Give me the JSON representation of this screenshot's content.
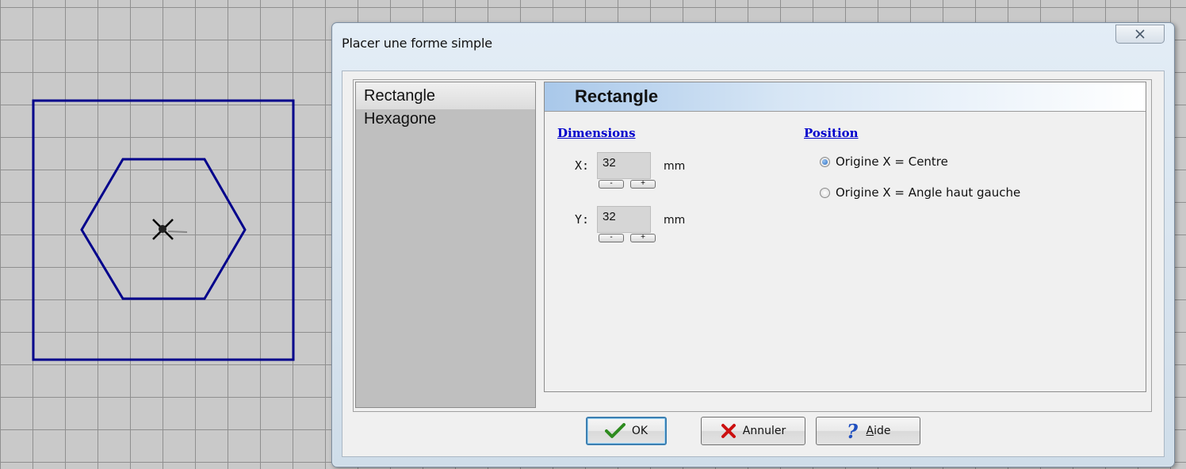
{
  "dialog": {
    "title": "Placer une forme simple",
    "close_icon": "close-x-icon"
  },
  "shapes": {
    "items": [
      {
        "label": "Rectangle",
        "selected": true
      },
      {
        "label": "Hexagone",
        "selected": false
      }
    ]
  },
  "detail": {
    "header": "Rectangle",
    "dimensions": {
      "title": "Dimensions",
      "x_label": "X:",
      "x_value": "32",
      "y_label": "Y:",
      "y_value": "32",
      "unit": "mm",
      "minus": "-",
      "plus": "+"
    },
    "position": {
      "title": "Position",
      "options": [
        {
          "label": "Origine X = Centre",
          "checked": true
        },
        {
          "label": "Origine X = Angle haut gauche",
          "checked": false
        }
      ]
    }
  },
  "buttons": {
    "ok": "OK",
    "cancel": "Annuler",
    "help_accel": "A",
    "help_rest": "ide"
  },
  "colors": {
    "shape_stroke": "#00008b",
    "section_title": "#0000cc",
    "ok_icon": "#2e8b1f",
    "cancel_icon": "#cc1010",
    "help_icon": "#1f4fbf"
  },
  "icons": [
    "close-x-icon",
    "checkmark-icon",
    "x-mark-icon",
    "question-mark-icon",
    "cursor-cross-icon"
  ]
}
